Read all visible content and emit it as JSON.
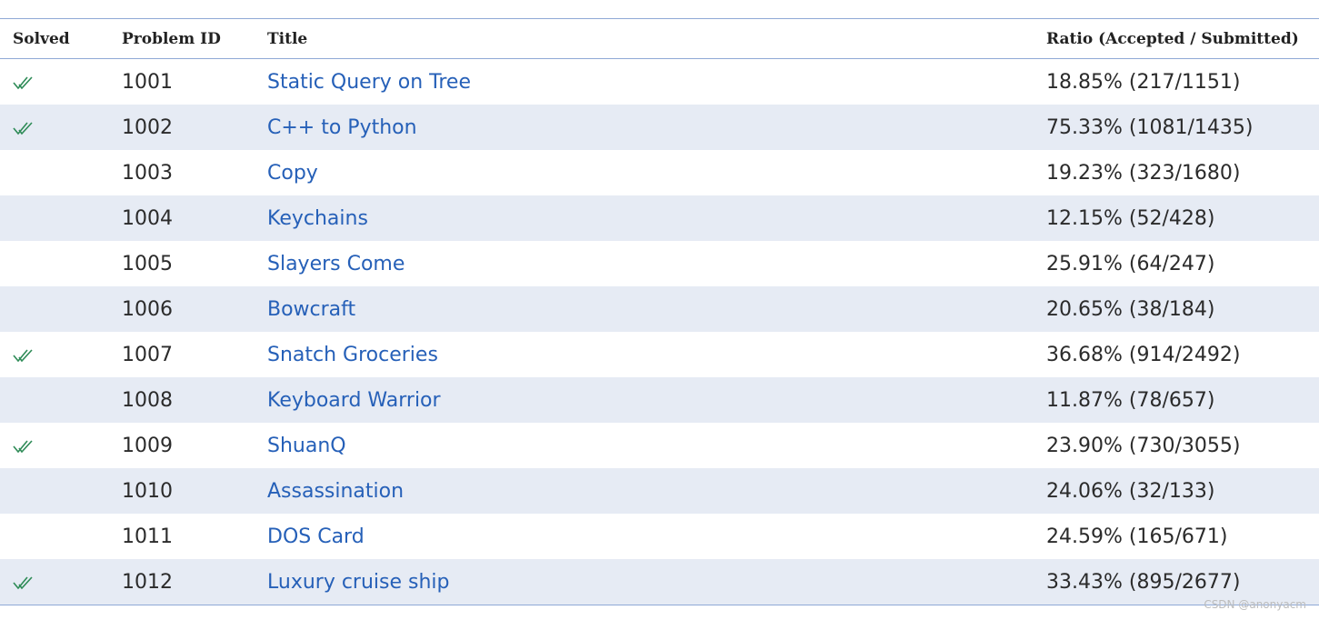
{
  "table": {
    "headers": {
      "solved": "Solved",
      "problem_id": "Problem ID",
      "title": "Title",
      "ratio": "Ratio (Accepted / Submitted)"
    },
    "rows": [
      {
        "solved": true,
        "id": "1001",
        "title": "Static Query on Tree",
        "ratio": "18.85% (217/1151)"
      },
      {
        "solved": true,
        "id": "1002",
        "title": "C++ to Python",
        "ratio": "75.33% (1081/1435)"
      },
      {
        "solved": false,
        "id": "1003",
        "title": "Copy",
        "ratio": "19.23% (323/1680)"
      },
      {
        "solved": false,
        "id": "1004",
        "title": "Keychains",
        "ratio": "12.15% (52/428)"
      },
      {
        "solved": false,
        "id": "1005",
        "title": "Slayers Come",
        "ratio": "25.91% (64/247)"
      },
      {
        "solved": false,
        "id": "1006",
        "title": "Bowcraft",
        "ratio": "20.65% (38/184)"
      },
      {
        "solved": true,
        "id": "1007",
        "title": "Snatch Groceries",
        "ratio": "36.68% (914/2492)"
      },
      {
        "solved": false,
        "id": "1008",
        "title": "Keyboard Warrior",
        "ratio": "11.87% (78/657)"
      },
      {
        "solved": true,
        "id": "1009",
        "title": "ShuanQ",
        "ratio": "23.90% (730/3055)"
      },
      {
        "solved": false,
        "id": "1010",
        "title": "Assassination",
        "ratio": "24.06% (32/133)"
      },
      {
        "solved": false,
        "id": "1011",
        "title": "DOS Card",
        "ratio": "24.59% (165/671)"
      },
      {
        "solved": true,
        "id": "1012",
        "title": "Luxury cruise ship",
        "ratio": "33.43% (895/2677)"
      }
    ]
  },
  "solved_icon": "double-check-icon",
  "colors": {
    "link": "#2660b8",
    "check": "#2e8b57",
    "alt_row": "#e6ebf4",
    "border": "#8fa9d6"
  },
  "watermark": "CSDN @anonyacm"
}
